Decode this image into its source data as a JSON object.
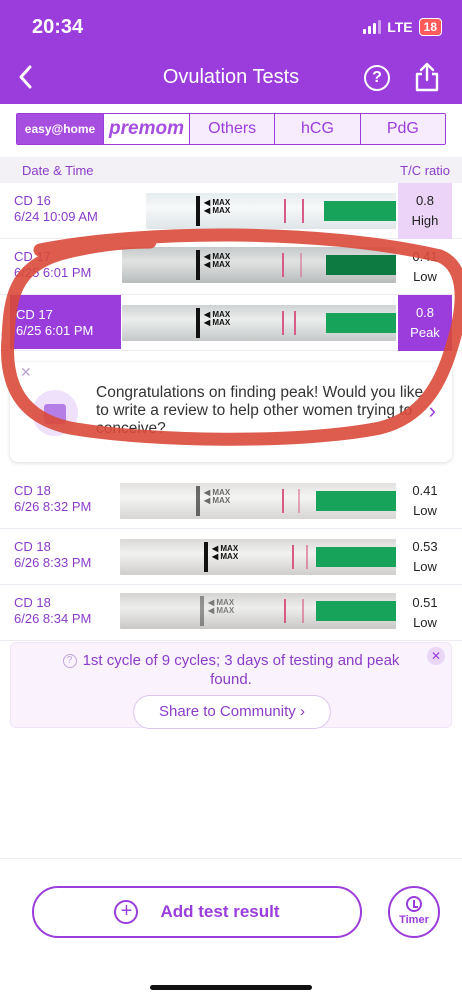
{
  "status_bar": {
    "time": "20:34",
    "network": "LTE",
    "battery": "18"
  },
  "header": {
    "title": "Ovulation Tests",
    "help_symbol": "?",
    "back_icon": "chevron-left-icon",
    "share_icon": "share-icon"
  },
  "brand_tabs": [
    {
      "label": "easy@home",
      "selected": false
    },
    {
      "label": "premom",
      "selected": true
    },
    {
      "label": "Others",
      "selected": false
    },
    {
      "label": "hCG",
      "selected": false
    },
    {
      "label": "PdG",
      "selected": false
    }
  ],
  "list_header": {
    "left": "Date & Time",
    "right": "T/C ratio"
  },
  "rows": [
    {
      "cd": "CD 16",
      "datetime": "6/24 10:09 AM",
      "ratio": "0.8",
      "level": "High"
    },
    {
      "cd": "CD 17",
      "datetime": "6/25 6:01 PM",
      "ratio": "0.41",
      "level": "Low"
    },
    {
      "cd": "CD 17",
      "datetime": "6/25 6:01 PM",
      "ratio": "0.8",
      "level": "Peak"
    },
    {
      "cd": "CD 18",
      "datetime": "6/26 8:32 PM",
      "ratio": "0.41",
      "level": "Low"
    },
    {
      "cd": "CD 18",
      "datetime": "6/26 8:33 PM",
      "ratio": "0.53",
      "level": "Low"
    },
    {
      "cd": "CD 18",
      "datetime": "6/26 8:34 PM",
      "ratio": "0.51",
      "level": "Low"
    }
  ],
  "strip_text": "MAX",
  "review_card": {
    "text": "Congratulations on finding peak! Would you like to write a review to help other women trying to conceive?"
  },
  "summary": {
    "text": "1st cycle of 9 cycles; 3 days of testing and peak found.",
    "button": "Share to Community"
  },
  "bottom": {
    "add_label": "Add test result",
    "timer_label": "Timer"
  },
  "colors": {
    "accent": "#9b3ddc",
    "annotation": "#d94a3a",
    "strip_green": "#17a35a"
  }
}
